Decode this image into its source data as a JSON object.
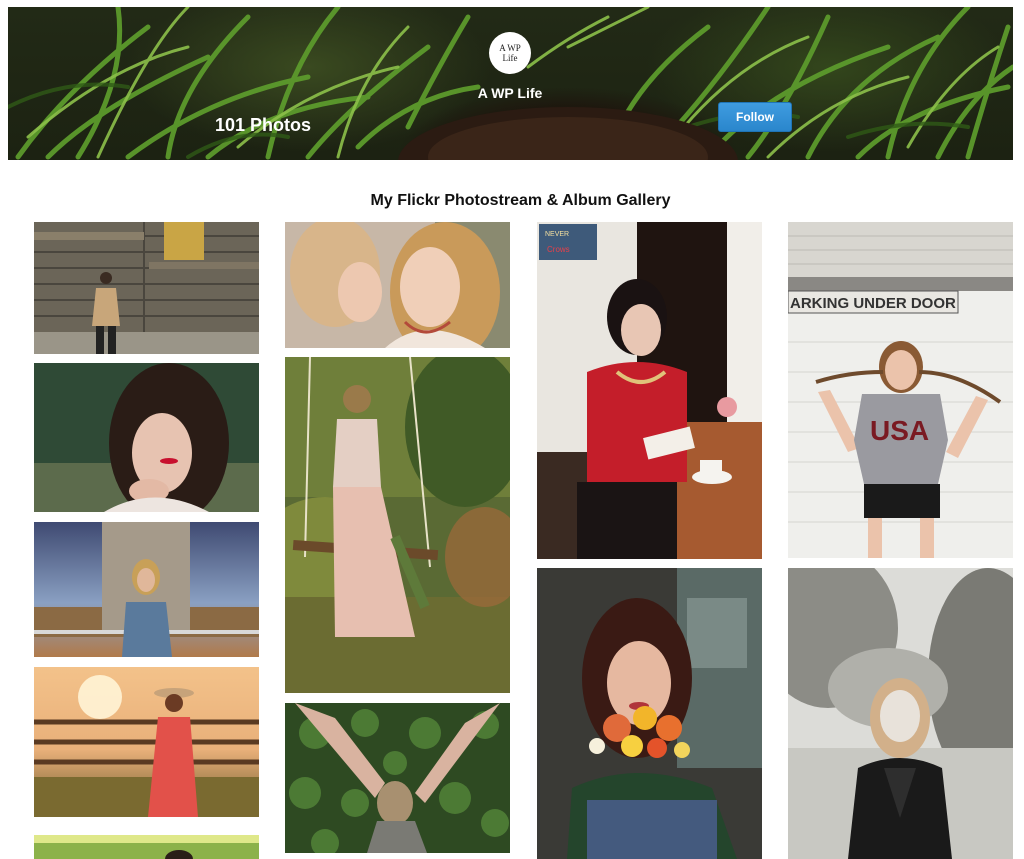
{
  "header": {
    "avatar_line1": "A WP",
    "avatar_line2": "Life",
    "account_name": "A WP Life",
    "photo_count": "101 Photos",
    "follow_label": "Follow"
  },
  "gallery": {
    "title": "My Flickr Photostream & Album Gallery"
  },
  "photos": {
    "p4_sign": "ARKING UNDER DOOR",
    "p4_shirt": "USA",
    "p3_poster_1": "NEVER",
    "p3_poster_2": "Crows"
  },
  "colors": {
    "follow_button": "#2a86cc",
    "banner_grass": "#4f8a2a"
  }
}
